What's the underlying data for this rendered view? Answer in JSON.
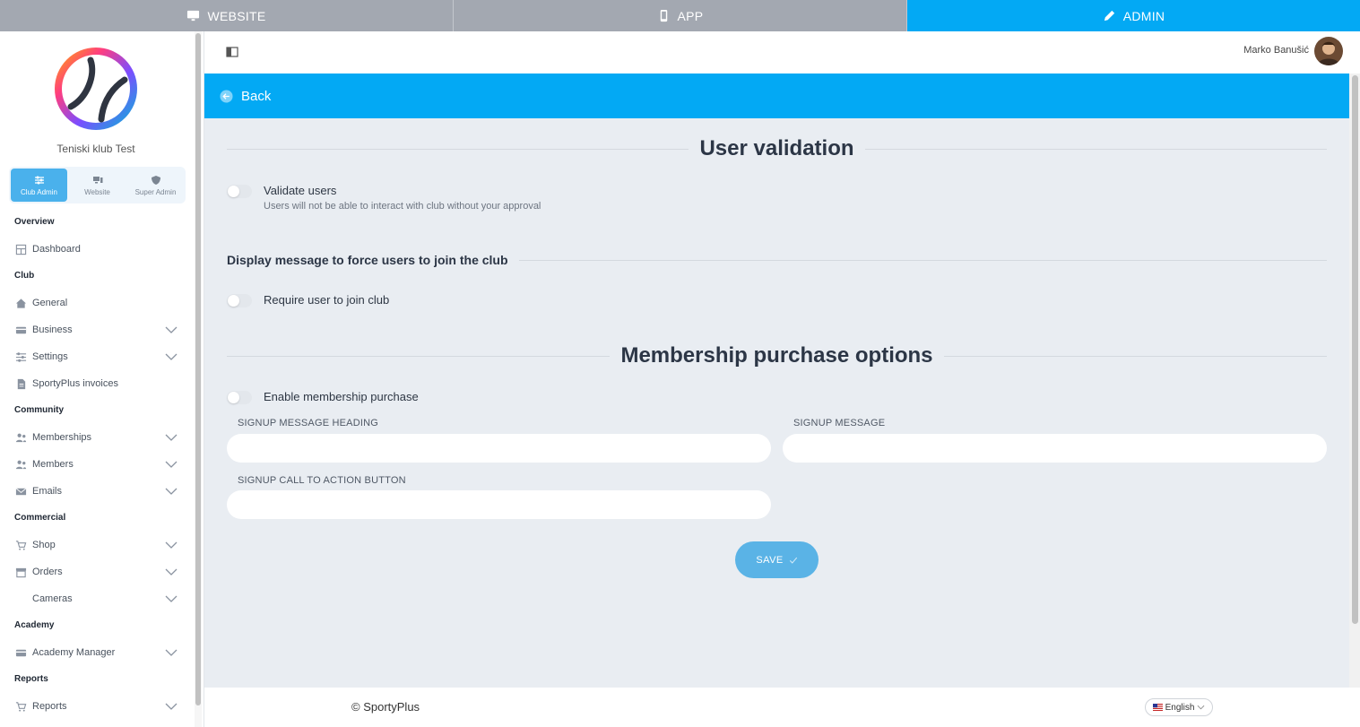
{
  "topbar": {
    "tabs": [
      {
        "label": "WEBSITE",
        "icon": "monitor-icon"
      },
      {
        "label": "APP",
        "icon": "phone-icon"
      },
      {
        "label": "ADMIN",
        "icon": "pencil-icon",
        "active": true
      }
    ]
  },
  "sidebar": {
    "club_name": "Teniski klub Test",
    "roles": [
      {
        "label": "Club Admin",
        "active": true
      },
      {
        "label": "Website"
      },
      {
        "label": "Super Admin"
      }
    ],
    "sections": {
      "overview": "Overview",
      "club": "Club",
      "community": "Community",
      "commercial": "Commercial",
      "academy": "Academy",
      "reports": "Reports"
    },
    "items": {
      "dashboard": "Dashboard",
      "general": "General",
      "business": "Business",
      "settings": "Settings",
      "invoices": "SportyPlus invoices",
      "memberships": "Memberships",
      "members": "Members",
      "emails": "Emails",
      "shop": "Shop",
      "orders": "Orders",
      "cameras": "Cameras",
      "academy_manager": "Academy Manager",
      "reports": "Reports"
    }
  },
  "header": {
    "username": "Marko Banušić"
  },
  "back": {
    "label": "Back"
  },
  "content": {
    "user_validation": {
      "title": "User validation",
      "validate_label": "Validate users",
      "validate_desc": "Users will not be able to interact with club without your approval"
    },
    "force_join": {
      "title": "Display message to force users to join the club",
      "require_label": "Require user to join club"
    },
    "membership": {
      "title": "Membership purchase options",
      "enable_label": "Enable membership purchase",
      "heading_label": "SIGNUP MESSAGE HEADING",
      "heading_value": "",
      "message_label": "SIGNUP MESSAGE",
      "message_value": "",
      "cta_label": "SIGNUP CALL TO ACTION BUTTON",
      "cta_value": ""
    },
    "save_label": "SAVE"
  },
  "footer": {
    "copyright": "© SportyPlus",
    "language": "English"
  },
  "colors": {
    "accent": "#03a9f4",
    "tab_inactive": "#a3a8b1",
    "content_bg": "#e9edf2",
    "save_button": "#5ab3e6"
  }
}
